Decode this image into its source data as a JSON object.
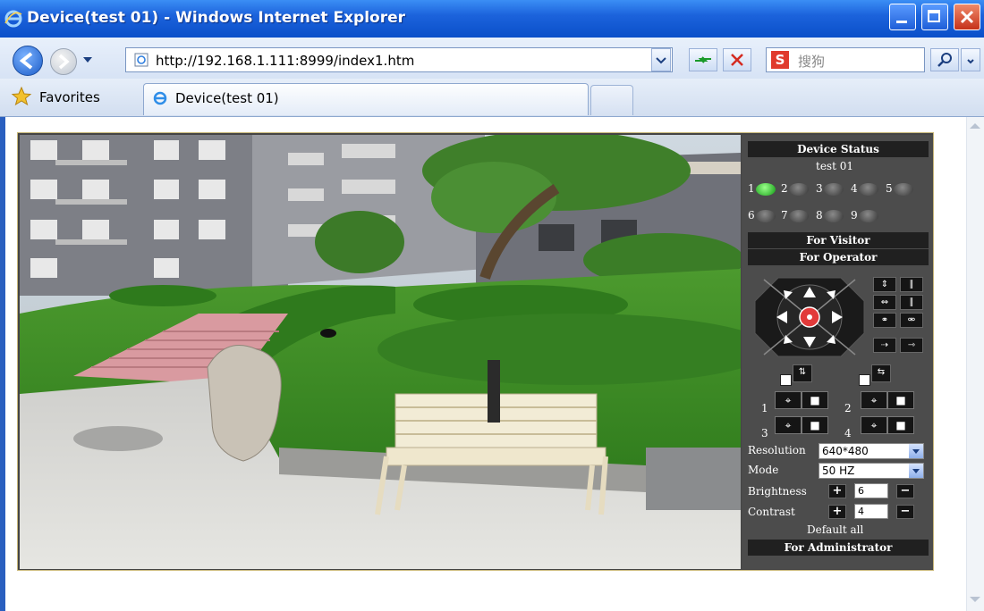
{
  "window": {
    "title": "Device(test 01) - Windows Internet Explorer"
  },
  "address": {
    "url": "http://192.168.1.111:8999/index1.htm"
  },
  "search": {
    "engine_icon_text": "S",
    "placeholder": "搜狗"
  },
  "favorites": {
    "label": "Favorites"
  },
  "tab": {
    "label": "Device(test 01)"
  },
  "panel": {
    "device_status": "Device Status",
    "device_name": "test 01",
    "sensors": [
      {
        "num": "1",
        "active": true
      },
      {
        "num": "2",
        "active": false
      },
      {
        "num": "3",
        "active": false
      },
      {
        "num": "4",
        "active": false
      },
      {
        "num": "5",
        "active": false
      },
      {
        "num": "6",
        "active": false
      },
      {
        "num": "7",
        "active": false
      },
      {
        "num": "8",
        "active": false
      },
      {
        "num": "9",
        "active": false
      }
    ],
    "for_visitor": "For Visitor",
    "for_operator": "For Operator",
    "for_administrator": "For Administrator",
    "preset_numbers": [
      "1",
      "2",
      "3",
      "4"
    ],
    "resolution_label": "Resolution",
    "resolution_value": "640*480",
    "mode_label": "Mode",
    "mode_value": "50 HZ",
    "brightness_label": "Brightness",
    "brightness_value": "6",
    "contrast_label": "Contrast",
    "contrast_value": "4",
    "plus": "+",
    "minus": "−",
    "default_all": "Default all"
  },
  "colors": {
    "sensor_on": "#0f9a12",
    "panel_bg": "#4c4c4c",
    "header_bg": "#202020",
    "title_bar": "#1c63dc"
  }
}
